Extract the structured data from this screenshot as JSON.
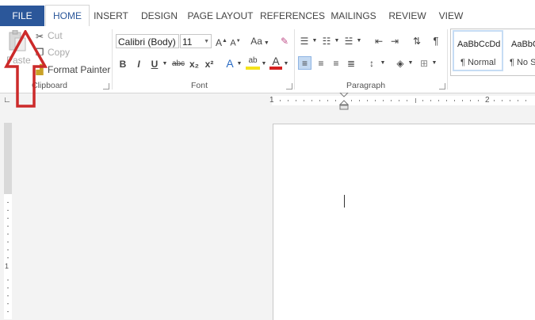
{
  "tabs": [
    {
      "label": "FILE"
    },
    {
      "label": "HOME"
    },
    {
      "label": "INSERT"
    },
    {
      "label": "DESIGN"
    },
    {
      "label": "PAGE LAYOUT"
    },
    {
      "label": "REFERENCES"
    },
    {
      "label": "MAILINGS"
    },
    {
      "label": "REVIEW"
    },
    {
      "label": "VIEW"
    }
  ],
  "clipboard": {
    "paste_label": "Paste",
    "cut_label": "Cut",
    "copy_label": "Copy",
    "format_painter_label": "Format Painter",
    "group_label": "Clipboard"
  },
  "font": {
    "font_name": "Calibri (Body)",
    "font_size": "11",
    "grow_label": "A",
    "shrink_label": "A",
    "case_label": "Aa",
    "bold": "B",
    "italic": "I",
    "underline": "U",
    "strike": "abc",
    "sub": "x₂",
    "sup": "x²",
    "effects": "A",
    "highlight": "ab",
    "color": "A",
    "group_label": "Font"
  },
  "paragraph": {
    "group_label": "Paragraph",
    "show_marks": "¶"
  },
  "styles": {
    "normal_preview": "AaBbCcDd",
    "normal_label": "¶ Normal",
    "nospacing_preview": "AaBbC",
    "nospacing_label": "¶ No S"
  },
  "ruler": {
    "tick_1": "1",
    "tick_2": "2",
    "vtick_1": "1"
  },
  "colors": {
    "file_tab": "#2b579a",
    "annotation_arrow": "#cc2a2a"
  }
}
